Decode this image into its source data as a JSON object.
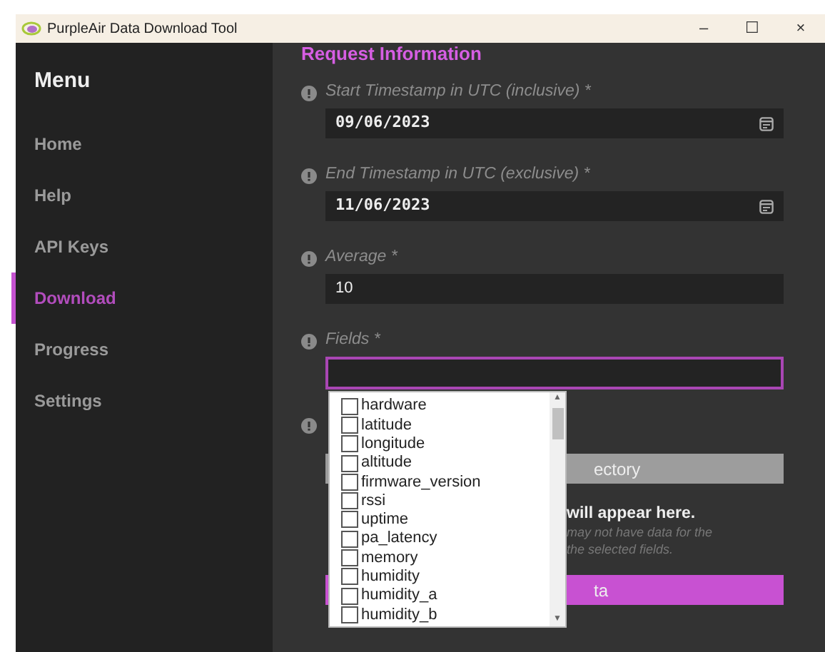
{
  "window": {
    "title": "PurpleAir Data Download Tool",
    "controls": [
      "–",
      "☐",
      "×"
    ]
  },
  "sidebar": {
    "title": "Menu",
    "items": [
      {
        "label": "Home",
        "selected": false
      },
      {
        "label": "Help",
        "selected": false
      },
      {
        "label": "API Keys",
        "selected": false
      },
      {
        "label": "Download",
        "selected": true
      },
      {
        "label": "Progress",
        "selected": false
      },
      {
        "label": "Settings",
        "selected": false
      }
    ]
  },
  "form": {
    "heading": "Request Information",
    "fields": [
      {
        "label": "Start Timestamp in UTC (inclusive) *",
        "value": "09/06/2023",
        "kind": "date",
        "focused": false
      },
      {
        "label": "End Timestamp in UTC (exclusive) *",
        "value": "11/06/2023",
        "kind": "date",
        "focused": false
      },
      {
        "label": "Average *",
        "value": "10",
        "kind": "text",
        "focused": false
      },
      {
        "label": "Fields *",
        "kind": "text",
        "focused": true
      }
    ],
    "directory_button": "ectory",
    "message": "will appear here.",
    "note_lines": [
      "may not have data for the",
      "the selected fields."
    ],
    "download_button": "ta"
  },
  "dropdown": {
    "options": [
      {
        "label": "hardware",
        "checked": false
      },
      {
        "label": "latitude",
        "checked": false
      },
      {
        "label": "longitude",
        "checked": false
      },
      {
        "label": "altitude",
        "checked": false
      },
      {
        "label": "firmware_version",
        "checked": false
      },
      {
        "label": "rssi",
        "checked": false
      },
      {
        "label": "uptime",
        "checked": false
      },
      {
        "label": "pa_latency",
        "checked": false
      },
      {
        "label": "memory",
        "checked": false
      },
      {
        "label": "humidity",
        "checked": false
      },
      {
        "label": "humidity_a",
        "checked": false
      },
      {
        "label": "humidity_b",
        "checked": false
      }
    ],
    "scroll_up": "▲",
    "scroll_down": "▼"
  }
}
